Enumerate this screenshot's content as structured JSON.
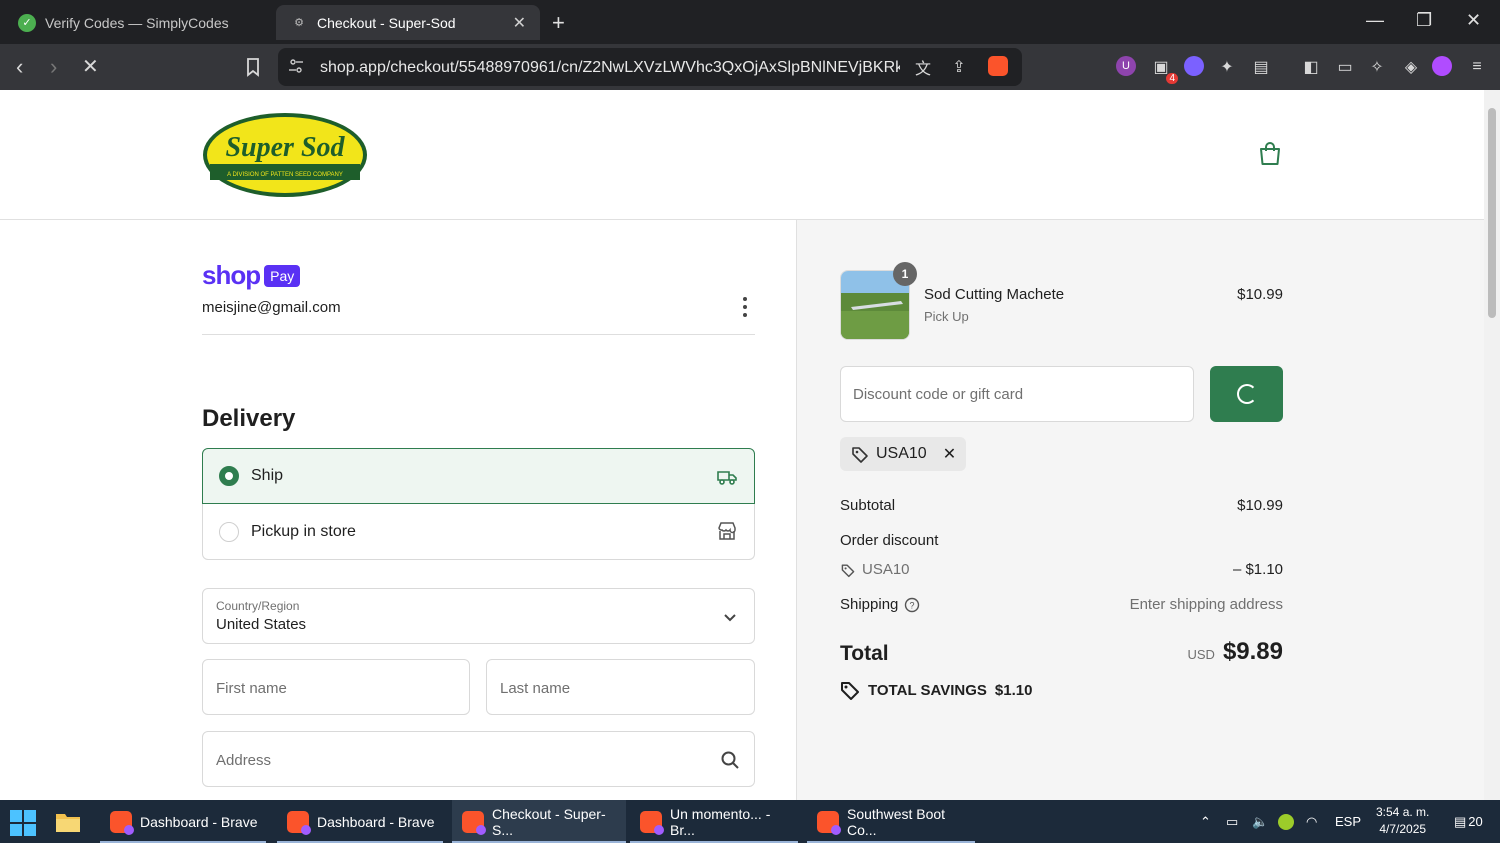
{
  "browser": {
    "tabs": [
      {
        "title": "Verify Codes — SimplyCodes",
        "active": false
      },
      {
        "title": "Checkout - Super-Sod",
        "active": true
      }
    ],
    "url": "shop.app/checkout/55488970961/cn/Z2NwLXVzLWVhc3QxOjAxSlpBNlNEVjBKRk41...",
    "extension_badge": "4"
  },
  "header": {
    "logo_text": "Super Sod",
    "logo_subtext": "A DIVISION OF PATTEN SEED COMPANY"
  },
  "account": {
    "brand_word": "shop",
    "brand_pill": "Pay",
    "email": "meisjine@gmail.com"
  },
  "delivery": {
    "title": "Delivery",
    "options": [
      {
        "label": "Ship",
        "selected": true
      },
      {
        "label": "Pickup in store",
        "selected": false
      }
    ],
    "country_label": "Country/Region",
    "country_value": "United States",
    "first_name_placeholder": "First name",
    "last_name_placeholder": "Last name",
    "address_placeholder": "Address"
  },
  "summary": {
    "item": {
      "quantity": "1",
      "name": "Sod Cutting Machete",
      "sub": "Pick Up",
      "price": "$10.99"
    },
    "discount_placeholder": "Discount code or gift card",
    "applied_code": "USA10",
    "subtotal_label": "Subtotal",
    "subtotal_value": "$10.99",
    "order_discount_label": "Order discount",
    "discount_code": "USA10",
    "discount_value": "– $1.10",
    "shipping_label": "Shipping",
    "shipping_value": "Enter shipping address",
    "total_label": "Total",
    "total_currency": "USD",
    "total_value": "$9.89",
    "savings_label": "TOTAL SAVINGS",
    "savings_value": "$1.10",
    "colors": {
      "accent": "#2f7d4f",
      "shop_pay": "#5a31f4"
    }
  },
  "taskbar": {
    "items": [
      {
        "label": "Dashboard - Brave"
      },
      {
        "label": "Dashboard - Brave"
      },
      {
        "label": "Checkout - Super-S..."
      },
      {
        "label": "Un momento... - Br..."
      },
      {
        "label": "Southwest Boot Co..."
      }
    ],
    "lang": "ESP",
    "time": "3:54 a. m.",
    "date": "4/7/2025",
    "notifications": "20"
  }
}
